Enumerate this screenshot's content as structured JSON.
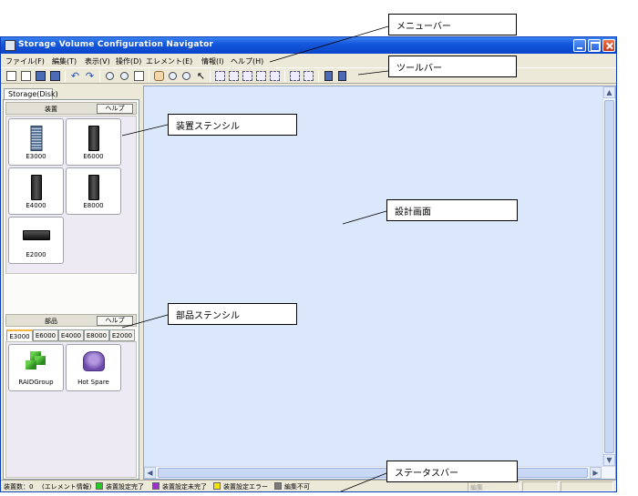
{
  "window": {
    "title": "Storage Volume Configuration Navigator"
  },
  "menu": {
    "items": [
      "ファイル(F)",
      "編集(T)",
      "表示(V)",
      "操作(D)",
      "エレメント(E)",
      "情報(I)",
      "ヘルプ(H)"
    ]
  },
  "left_panel": {
    "tab": "Storage(Disk)",
    "device_stencil": {
      "header": "装置",
      "help_label": "ヘルプ",
      "items": [
        {
          "label": "E3000",
          "icon": "blade-array-icon"
        },
        {
          "label": "E6000",
          "icon": "tower-icon"
        },
        {
          "label": "E4000",
          "icon": "tower-icon"
        },
        {
          "label": "E8000",
          "icon": "tower-icon"
        },
        {
          "label": "E2000",
          "icon": "flat-array-icon"
        }
      ]
    },
    "parts_stencil": {
      "header": "部品",
      "help_label": "ヘルプ",
      "tabs": [
        "E3000",
        "E6000",
        "E4000",
        "E8000",
        "E2000"
      ],
      "active_tab": "E3000",
      "items": [
        {
          "label": "RAIDGroup",
          "icon": "raid-group-icon"
        },
        {
          "label": "Hot Spare",
          "icon": "hot-spare-icon"
        }
      ]
    }
  },
  "statusbar": {
    "device_count": "装置数：0",
    "element_info": "(エレメント情報)",
    "legend": [
      {
        "label": "装置設定完了",
        "color": "#22cc22"
      },
      {
        "label": "装置設定未完了",
        "color": "#9b2fcf"
      },
      {
        "label": "装置設定エラー",
        "color": "#f2e600"
      },
      {
        "label": "編集不可",
        "color": "#7a7a7a"
      }
    ],
    "right_cell": "編集"
  },
  "callouts": {
    "menubar": "メニューバー",
    "toolbar": "ツールバー",
    "device_stencil": "装置ステンシル",
    "design_canvas": "設計画面",
    "parts_stencil": "部品ステンシル",
    "statusbar": "ステータスバー"
  },
  "colors": {
    "titlebar": "#1458dd",
    "canvas": "#dbe8fb",
    "chrome": "#ece9d8"
  }
}
